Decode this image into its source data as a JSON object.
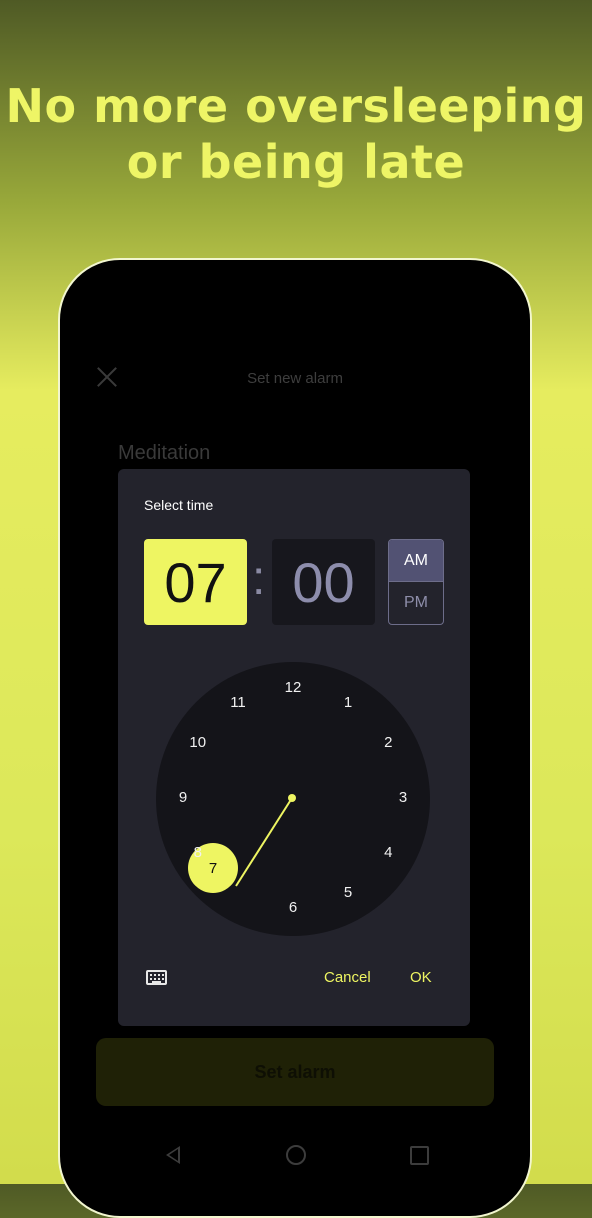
{
  "headline": {
    "line1": "No more oversleeping",
    "line2": "or being late"
  },
  "appbar": {
    "title": "Set new alarm",
    "close_icon": "close-icon"
  },
  "alarm_label": "Meditation",
  "primary_button": "Set alarm",
  "dialog": {
    "title": "Select time",
    "hour": "07",
    "separator": ":",
    "minute": "00",
    "am": "AM",
    "pm": "PM",
    "selected_period": "AM",
    "clock_numbers": [
      "12",
      "1",
      "2",
      "3",
      "4",
      "5",
      "6",
      "7",
      "8",
      "9",
      "10",
      "11"
    ],
    "selected_hour": "7",
    "cancel": "Cancel",
    "ok": "OK",
    "keyboard_icon": "keyboard-icon"
  },
  "colors": {
    "accent": "#eef562",
    "dialog_bg": "#23232c",
    "clock_bg": "#141419",
    "ampm_selected": "#525273"
  },
  "navbar": {
    "back_icon": "back-icon",
    "home_icon": "home-icon",
    "recents_icon": "recents-icon"
  }
}
